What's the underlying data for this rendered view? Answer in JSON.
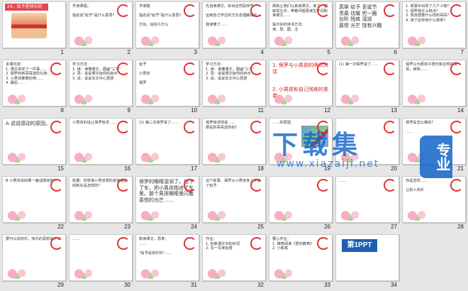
{
  "slides": [
    {
      "num": "1",
      "lines": "24、给予是快乐的",
      "kind": "cover"
    },
    {
      "num": "2",
      "lines": "齐读课题。\n\n指名说\"给予\"是什么意思？"
    },
    {
      "num": "3",
      "lines": "齐读题\n\n指名说\"给予\"是什么意思？\n\n付出，给别人什么"
    },
    {
      "num": "4",
      "lines": "先自读课文，标出自然段序号\n\n运用自己学过的方法去理解课文\n\n我读懂了……"
    },
    {
      "num": "5",
      "lines": "那就让我们认真读课文，读了一遍就举左手，带着问题再读生字词和读课文……\n\n提示好的读书方法：\n读、思、圈、注"
    },
    {
      "num": "6",
      "lines": "真挚 给予 圣诞节\n羡慕 炫耀 兜一圈\n台阶 残疾 湿润\n嘉悦 光芒 饶有兴趣",
      "kind": "bold"
    },
    {
      "num": "7",
      "lines": "1. 故事中出现了几个人物？\n2. 保罗有什么特点？\n3. 男孩想要什么样的哥哥？\n4. 读了后你有什么感受？"
    },
    {
      "num": "8",
      "lines": "本课内容：\n1. 课文讲述了一件事……\n2. 保罗收到哥哥送的礼物……\n3. 小男孩推着轮椅……\n4. 最后……"
    },
    {
      "num": "9",
      "lines": "学习方法：\n1. 读：读懂课文，圈画\"三不\"\n2. 思：说说课文给你的启示\n3. 说：说说本文中心思想"
    },
    {
      "num": "10",
      "lines": "给予\n\n小男孩\n\n保罗"
    },
    {
      "num": "11",
      "lines": "学习方法：\n1. 读：读懂课文，圈画\"三不\"\n2. 思：说说课文给你的启示\n3. 说：说说本文中心思想"
    },
    {
      "num": "12",
      "lines": "1. 保罗与小男孩的两次对话\n\n\n2. 小男孩和自己残疾的弟弟",
      "kind": "red"
    },
    {
      "num": "13",
      "lines": "(1) 第一次保罗说了……"
    },
    {
      "num": "14",
      "lines": "保罗以为那孩子想也有这样的哥哥，谁知……"
    },
    {
      "num": "15",
      "lines": "A 说说感动的原因。",
      "kind": "big"
    },
    {
      "num": "16",
      "lines": "小男孩的话让保罗惊讶……"
    },
    {
      "num": "17",
      "lines": "(2) 第二次保罗说了……"
    },
    {
      "num": "18",
      "lines": "保罗惊讶地说……\n那是你哥哥送你的？"
    },
    {
      "num": "19",
      "lines": "……的原因",
      "kind": "img"
    },
    {
      "num": "20",
      "lines": ""
    },
    {
      "num": "21",
      "lines": "保罗是怎么做的？\n\n……"
    },
    {
      "num": "22",
      "lines": "B 小男孩说的哪一番话感动你？"
    },
    {
      "num": "23",
      "lines": "拓展：你觉得小男孩想向弟弟描述的新车是怎样的？"
    },
    {
      "num": "24",
      "lines": "保罗的眼睛湿润了。他下了车，把小男孩抱进了车里。那个男孩眼睛里闪着喜悦的光芒……",
      "kind": "bold"
    },
    {
      "num": "25",
      "lines": "这个故事，保罗从小男孩身上学会了给予"
    },
    {
      "num": "26",
      "lines": ""
    },
    {
      "num": "27",
      "lines": "……"
    },
    {
      "num": "28",
      "lines": "你是怎样……\n\n让别人快乐"
    },
    {
      "num": "29",
      "lines": "要可以说快乐，快乐的源泉是什么"
    },
    {
      "num": "30",
      "lines": "……"
    },
    {
      "num": "31",
      "lines": "默读课文，思考：\n……\n\n\"给予是快乐的\"……"
    },
    {
      "num": "32",
      "lines": "作业：\n1. 积累课文中的好词\n2. 写一写读后感"
    },
    {
      "num": "33",
      "lines": "要心作业：\n1. 推荐阅读《爱的教育》\n2. 小练笔"
    },
    {
      "num": "34",
      "lines": "",
      "kind": "logo",
      "logo": "第1PPT"
    }
  ],
  "watermark": {
    "title": "下载集",
    "tag": "专业",
    "url": "www.xiazaiji.net"
  }
}
